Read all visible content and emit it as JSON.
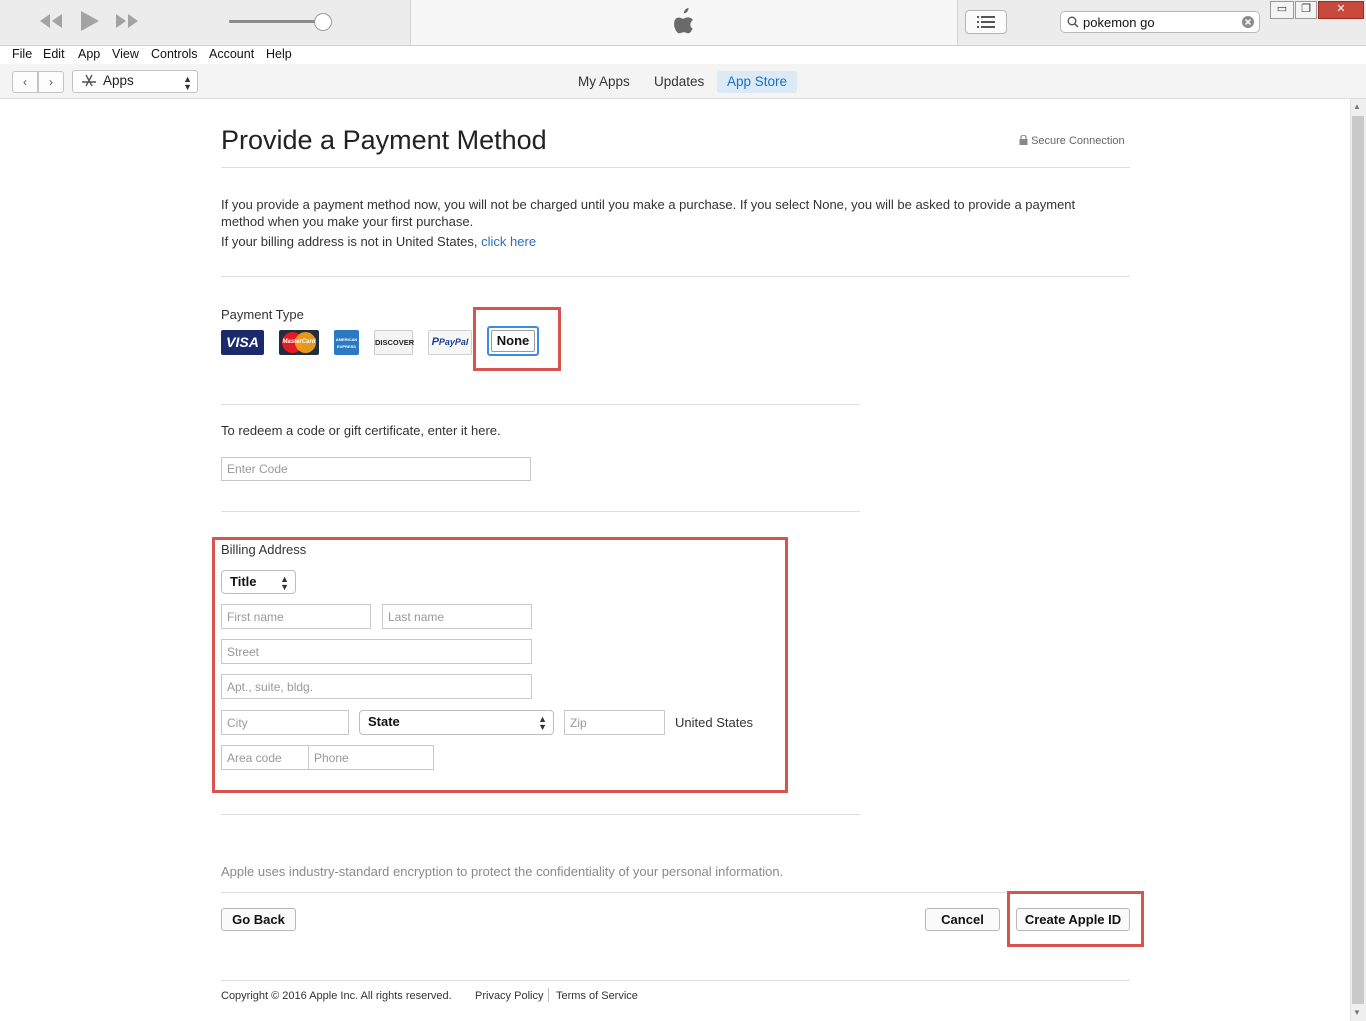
{
  "player": {
    "rewind_icon": "rewind-icon",
    "play_icon": "play-icon",
    "forward_icon": "fast-forward-icon",
    "volume_level": 0.92,
    "apple_logo": "apple-logo",
    "list_icon": "list-icon"
  },
  "search": {
    "value": "pokemon go",
    "icon": "search-icon",
    "clear_icon": "clear-icon"
  },
  "window_controls": {
    "minimize": "▭",
    "restore": "❐",
    "close": "✕"
  },
  "menu": [
    "File",
    "Edit",
    "App",
    "View",
    "Controls",
    "Account",
    "Help"
  ],
  "nav": {
    "back": "‹",
    "forward": "›",
    "media_selector": "Apps",
    "tabs": [
      "My Apps",
      "Updates",
      "App Store"
    ],
    "active_tab": "App Store"
  },
  "page": {
    "title": "Provide a Payment Method",
    "secure": "Secure Connection",
    "intro_line1": "If you provide a payment method now, you will not be charged until you make a purchase. If you select None, you will be asked to provide a payment",
    "intro_line2": "method when you make your first purchase.",
    "intro_line3": "If your billing address is not in United States, ",
    "intro_link": "click here"
  },
  "payment": {
    "label": "Payment Type",
    "cards": [
      "VISA",
      "MasterCard",
      "AMERICAN EXPRESS",
      "DISCOVER",
      "PayPal"
    ],
    "none_label": "None"
  },
  "redeem": {
    "label": "To redeem a code or gift certificate, enter it here.",
    "placeholder": "Enter Code"
  },
  "billing": {
    "label": "Billing Address",
    "title_select": "Title",
    "first_name": "First name",
    "last_name": "Last name",
    "street": "Street",
    "apt": "Apt., suite, bldg.",
    "city": "City",
    "state_select": "State",
    "zip": "Zip",
    "country": "United States",
    "area_code": "Area code",
    "phone": "Phone"
  },
  "privacy_note": "Apple uses industry-standard encryption to protect the confidentiality of your personal information.",
  "buttons": {
    "go_back": "Go Back",
    "cancel": "Cancel",
    "create": "Create Apple ID"
  },
  "footer": {
    "copyright": "Copyright © 2016 Apple Inc. All rights reserved.",
    "privacy": "Privacy Policy",
    "terms": "Terms of Service"
  },
  "colors": {
    "accent": "#2a6ebb",
    "highlight": "#d9534f",
    "tab_active_bg": "#dceaf8"
  }
}
